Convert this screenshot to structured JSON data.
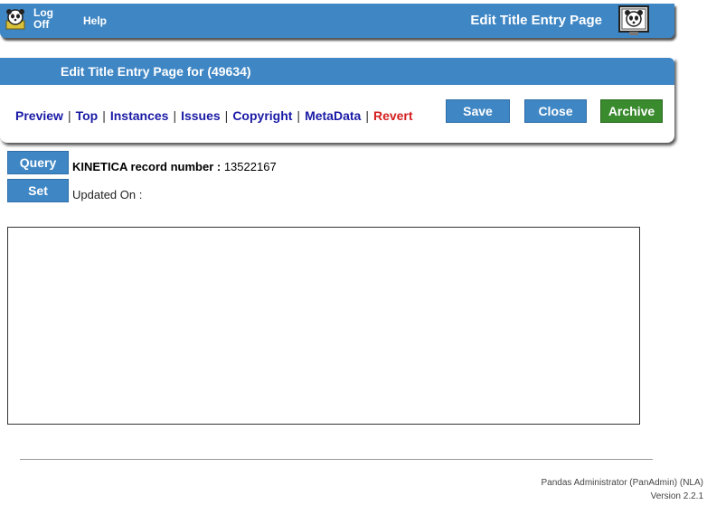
{
  "topbar": {
    "logoff_label": "Log\nOff",
    "help_label": "Help",
    "page_title": "Edit Title Entry Page",
    "logoff_icon": "panda-face-icon",
    "panda_icon": "panda-monitor-icon"
  },
  "panel": {
    "title": "Edit Title Entry Page for (49634)",
    "nav": [
      "Preview",
      "Top",
      "Instances",
      "Issues",
      "Copyright",
      "MetaData",
      "Revert"
    ],
    "buttons": {
      "save": "Save",
      "close": "Close",
      "archive": "Archive"
    }
  },
  "record": {
    "query_label": "Query",
    "set_label": "Set",
    "kinetica_label": "KINETICA record number :",
    "kinetica_value": "13522167",
    "updated_label": "Updated On :"
  },
  "footer": {
    "line1": "Pandas Administrator (PanAdmin) (NLA)",
    "line2": "Version 2.2.1"
  },
  "colors": {
    "banner": "#3f86c4",
    "link": "#1a1aa6",
    "revert": "#d42020",
    "archive": "#3a8a2e"
  }
}
